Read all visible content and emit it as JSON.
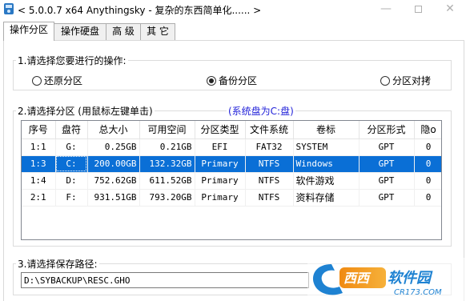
{
  "window": {
    "title": "< 5.0.0.7 x64 Anythingsky - 复杂的东西简单化...... >",
    "controls": {
      "minimize": "—",
      "close": "✕"
    }
  },
  "tabs": [
    {
      "label": "操作分区",
      "active": true
    },
    {
      "label": "操作硬盘",
      "active": false
    },
    {
      "label": "高 级",
      "active": false
    },
    {
      "label": "其 它",
      "active": false
    }
  ],
  "operation": {
    "title": "1.请选择您要进行的操作:",
    "options": [
      {
        "label": "还原分区",
        "selected": false
      },
      {
        "label": "备份分区",
        "selected": true
      },
      {
        "label": "分区对拷",
        "selected": false
      }
    ]
  },
  "partition": {
    "title": "2.请选择分区 (用鼠标左键单击)",
    "system_note": "(系统盘为C:盘)",
    "columns": [
      "序号",
      "盘符",
      "总大小",
      "可用空间",
      "分区类型",
      "文件系统",
      "卷标",
      "分区形式",
      "隐o"
    ],
    "rows": [
      {
        "cells": [
          "1:1",
          "G:",
          "0.25GB",
          "0.21GB",
          "EFI",
          "FAT32",
          "SYSTEM",
          "GPT",
          "0"
        ],
        "selected": false
      },
      {
        "cells": [
          "1:3",
          "C:",
          "200.00GB",
          "132.32GB",
          "Primary",
          "NTFS",
          "Windows",
          "GPT",
          "0"
        ],
        "selected": true
      },
      {
        "cells": [
          "1:4",
          "D:",
          "752.62GB",
          "611.52GB",
          "Primary",
          "NTFS",
          "软件游戏",
          "GPT",
          "0"
        ],
        "selected": false
      },
      {
        "cells": [
          "2:1",
          "F:",
          "931.51GB",
          "793.20GB",
          "Primary",
          "NTFS",
          "资料存储",
          "GPT",
          "0"
        ],
        "selected": false
      }
    ]
  },
  "save": {
    "title": "3.请选择保存路径:",
    "path": "D:\\SYBACKUP\\RESC.GHO"
  },
  "watermark": {
    "name": "西西软件园",
    "domain": "CR173.COM",
    "colors": {
      "orange": "#f08a12",
      "blue": "#1e82d2"
    }
  }
}
